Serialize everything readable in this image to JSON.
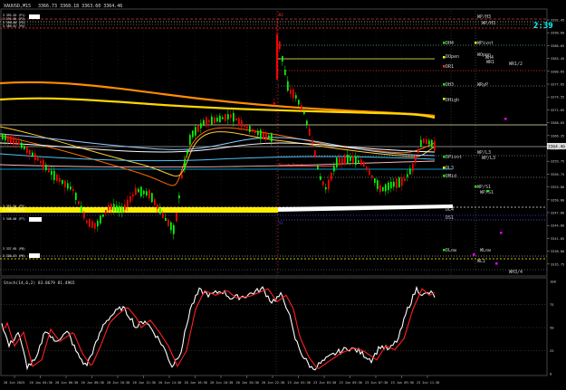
{
  "window": {
    "title": "XAUUSD,M15",
    "ohlc": "3366.73 3368.18 3363.60 3364.46",
    "timer": "2:39"
  },
  "subwindow": {
    "title": "Stoch(14,6,2) 83.8679 81.4965",
    "levels": [
      "100",
      "75",
      "50",
      "25",
      "0"
    ]
  },
  "price_axis": [
    "3392.45",
    "3390.60",
    "3386.65",
    "3383.45",
    "3380.65",
    "3377.65",
    "3374.55",
    "3371.65",
    "3368.65",
    "3366.35",
    "3362.70",
    "3359.75",
    "3356.75",
    "3353.80",
    "3350.80",
    "3347.80",
    "3344.80",
    "3341.85",
    "3338.80",
    "3335.75"
  ],
  "current_price": "3364.46",
  "time_axis": [
    "20 Jun 2025",
    "20 Jun 04:30",
    "20 Jun 06:30",
    "20 Jun 08:30",
    "20 Jun 10:30",
    "20 Jun 12:30",
    "20 Jun 14:30",
    "20 Jun 16:30",
    "20 Jun 18:30",
    "20 Jun 20:30",
    "20 Jun 22:30",
    "23 Jun 01:30",
    "23 Jun 03:30",
    "23 Jun 05:30",
    "23 Jun 07:30",
    "23 Jun 09:30",
    "23 Jun 11:30"
  ],
  "level_labels": {
    "top_left_1": "3 392.45 (P1)",
    "top_left_2": "3 391.65 (P2)",
    "top_left_3": "3 390.60 (P3)",
    "top_left_4": "3 389.42 (P4)",
    "mid_left_1": "3 351.84 (P5)",
    "mid_left_2": "3 350.60 (P6)",
    "mid_left_3": "3 348.00 (P7)",
    "low_left_1": "3 337.65 (P8)",
    "low_left_2": "3 336.87 (P9)",
    "pivot_point": "Pivot Point",
    "r2": "R2",
    "s1": "S1",
    "dh4": "DH4",
    "wpivot": "WPivot",
    "dopen": "DOpen",
    "wopen": "WOpen",
    "wh4": "WH4",
    "dr1": "DR1",
    "wr1": "WR1",
    "wr12": "WR1/2",
    "dh3": "DH3",
    "wrp": "WRyP",
    "dhigh": "DHigh",
    "dpivot": "DPivot",
    "wpl3": "WP/L3",
    "dl3": "DL3",
    "wpl3b": "WP/L3",
    "dmid": "DMid",
    "wps1": "WP/S1",
    "wps1b": "WP/S1",
    "dl4": "DL4",
    "ds1": "DS1",
    "dlow": "DLow",
    "wlow": "WLow",
    "wpg": "WP/H3",
    "wpg2": "WP/H3",
    "wh34": "WH3/4",
    "wl1": "WL1"
  },
  "colors": {
    "background": "#000000",
    "bull": "#00ff00",
    "bear": "#ff0000",
    "ema_orange": "#ff8c00",
    "ema_yellow": "#ffd700",
    "ema_cyan": "#00bfff",
    "band_yellow": "#ffff00",
    "grid": "#2a2a2a"
  }
}
